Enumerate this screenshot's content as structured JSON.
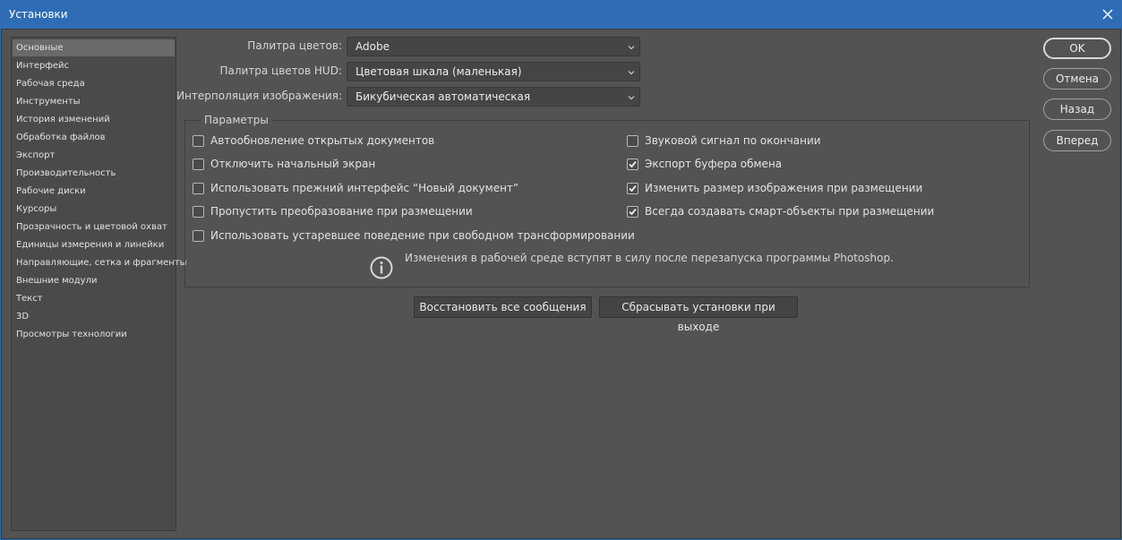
{
  "window": {
    "title": "Установки"
  },
  "sidebar": {
    "items": [
      {
        "label": "Основные",
        "active": true
      },
      {
        "label": "Интерфейс"
      },
      {
        "label": "Рабочая среда"
      },
      {
        "label": "Инструменты"
      },
      {
        "label": "История изменений"
      },
      {
        "label": "Обработка файлов"
      },
      {
        "label": "Экспорт"
      },
      {
        "label": "Производительность"
      },
      {
        "label": "Рабочие диски"
      },
      {
        "label": "Курсоры"
      },
      {
        "label": "Прозрачность и цветовой охват"
      },
      {
        "label": "Единицы измерения и линейки"
      },
      {
        "label": "Направляющие, сетка и фрагменты"
      },
      {
        "label": "Внешние модули"
      },
      {
        "label": "Текст"
      },
      {
        "label": "3D"
      },
      {
        "label": "Просмотры технологии"
      }
    ]
  },
  "fields": {
    "color_picker": {
      "label": "Палитра цветов:",
      "value": "Adobe"
    },
    "hud_color_picker": {
      "label": "Палитра цветов HUD:",
      "value": "Цветовая шкала (маленькая)"
    },
    "image_interpolation": {
      "label": "Интерполяция изображения:",
      "value": "Бикубическая автоматическая"
    }
  },
  "options": {
    "legend": "Параметры",
    "left": [
      {
        "label": "Автообновление открытых документов",
        "checked": false
      },
      {
        "label": "Отключить начальный экран",
        "checked": false
      },
      {
        "label": "Использовать прежний интерфейс “Новый документ”",
        "checked": false
      },
      {
        "label": "Пропустить преобразование при размещении",
        "checked": false
      },
      {
        "label": "Использовать устаревшее поведение при свободном трансформировании",
        "checked": false
      }
    ],
    "right": [
      {
        "label": "Звуковой сигнал по окончании",
        "checked": false
      },
      {
        "label": "Экспорт буфера обмена",
        "checked": true
      },
      {
        "label": "Изменить размер изображения при размещении",
        "checked": true
      },
      {
        "label": "Всегда создавать смарт-объекты при размещении",
        "checked": true
      }
    ],
    "info_text": "Изменения в рабочей среде вступят в силу после перезапуска программы Photoshop."
  },
  "bottom_buttons": {
    "restore": "Восстановить все сообщения",
    "reset": "Сбрасывать установки при выходе"
  },
  "side_buttons": {
    "ok": "OK",
    "cancel": "Отмена",
    "back": "Назад",
    "forward": "Вперед"
  },
  "colors": {
    "titlebar": "#2e6db6",
    "panel": "#535353",
    "sidebar": "#4a4a4a"
  }
}
